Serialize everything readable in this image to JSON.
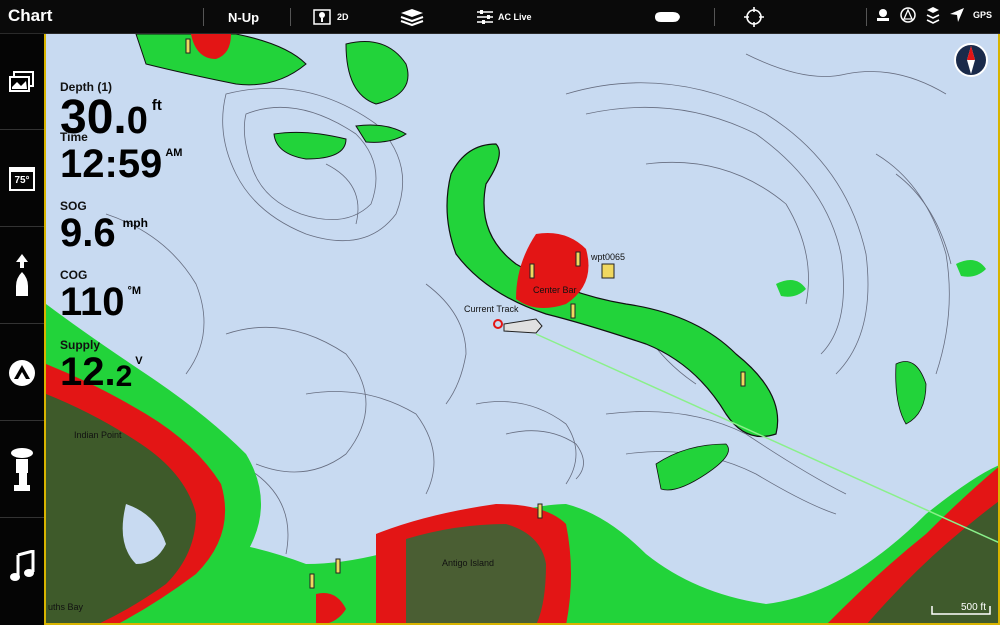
{
  "topbar": {
    "title": "Chart",
    "orientation": "N-Up",
    "view_mode": "2D",
    "layers_icon": "layers-icon",
    "ac_live": "AC Live",
    "status_gps": "GPS"
  },
  "readouts": {
    "depth": {
      "label": "Depth (1)",
      "main": "30.",
      "dec": "0",
      "unit": "ft"
    },
    "time": {
      "label": "Time",
      "main": "12:59",
      "unit": "AM"
    },
    "sog": {
      "label": "SOG",
      "main": "9.6",
      "unit": "mph"
    },
    "cog": {
      "label": "COG",
      "main": "110",
      "unit": "°M"
    },
    "supply": {
      "label": "Supply",
      "main": "12.",
      "dec": "2",
      "unit": "V"
    }
  },
  "sidebar": [
    {
      "icon": "views-icon"
    },
    {
      "icon": "temperature-icon",
      "value": "75°"
    },
    {
      "icon": "navigation-icon"
    },
    {
      "icon": "autochart-icon"
    },
    {
      "icon": "trolling-motor-icon"
    },
    {
      "icon": "music-icon"
    }
  ],
  "map_labels": {
    "indian_point": "Indian Point",
    "antigo_island": "Antigo Island",
    "souths_bay": "uths Bay",
    "center_bar": "Center Bar",
    "waypoint": "wpt0065",
    "current_track": "Current Track"
  },
  "scale": "500 ft",
  "colors": {
    "water": "#c8daf1",
    "shallow": "#22d33a",
    "danger": "#e31515",
    "land": "#3e5a2a",
    "frame": "#d8b400"
  }
}
